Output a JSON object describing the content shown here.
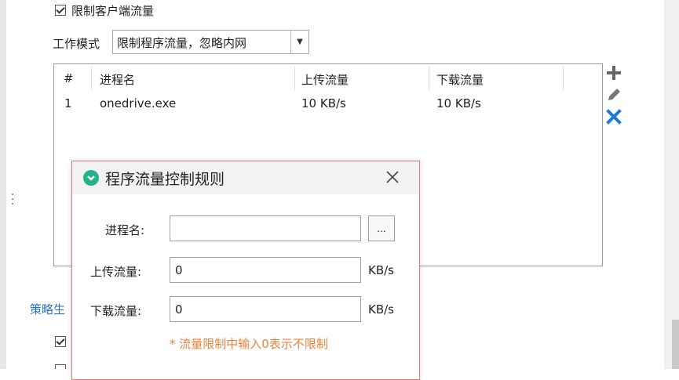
{
  "settings": {
    "limit_client_traffic_label": "限制客户端流量",
    "work_mode_label": "工作模式",
    "work_mode_value": "限制程序流量，忽略内网",
    "policy_link_text": "策略生"
  },
  "table": {
    "headers": [
      "#",
      "进程名",
      "上传流量",
      "下载流量"
    ],
    "rows": [
      {
        "index": "1",
        "process": "onedrive.exe",
        "upload": "10 KB/s",
        "download": "10 KB/s"
      }
    ]
  },
  "tools": {
    "add_icon": "plus-icon",
    "edit_icon": "pencil-icon",
    "delete_icon": "x-icon",
    "delete_color": "#1a7ad8"
  },
  "dialog": {
    "title": "程序流量控制规则",
    "process_label": "进程名:",
    "process_value": "",
    "browse_label": "...",
    "upload_label": "上传流量:",
    "upload_value": "0",
    "upload_unit": "KB/s",
    "download_label": "下载流量:",
    "download_value": "0",
    "download_unit": "KB/s",
    "hint": "* 流量限制中输入0表示不限制",
    "logo_color": "#22b38a",
    "hint_color": "#e8823a"
  }
}
